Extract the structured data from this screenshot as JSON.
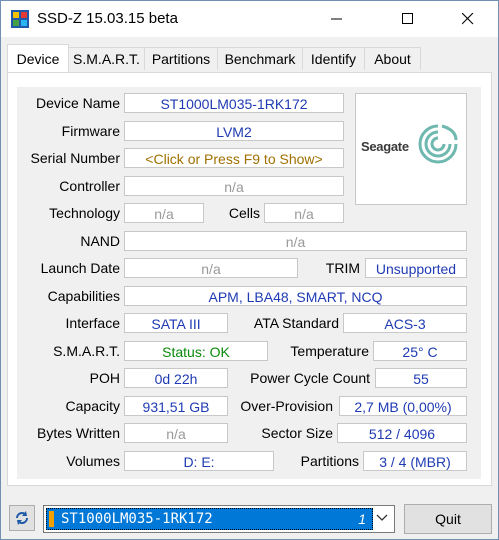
{
  "window": {
    "title": "SSD-Z 15.03.15 beta"
  },
  "tabs": [
    "Device",
    "S.M.A.R.T.",
    "Partitions",
    "Benchmark",
    "Identify",
    "About"
  ],
  "device": {
    "device_name_label": "Device Name",
    "device_name": "ST1000LM035-1RK172",
    "firmware_label": "Firmware",
    "firmware": "LVM2",
    "serial_label": "Serial Number",
    "serial": "<Click or Press F9 to Show>",
    "controller_label": "Controller",
    "controller": "n/a",
    "technology_label": "Technology",
    "technology": "n/a",
    "cells_label": "Cells",
    "cells": "n/a",
    "nand_label": "NAND",
    "nand": "n/a",
    "launch_label": "Launch Date",
    "launch": "n/a",
    "trim_label": "TRIM",
    "trim": "Unsupported",
    "capabilities_label": "Capabilities",
    "capabilities": "APM, LBA48, SMART, NCQ",
    "interface_label": "Interface",
    "interface": "SATA III",
    "ata_label": "ATA Standard",
    "ata": "ACS-3",
    "smart_label": "S.M.A.R.T.",
    "smart": "Status: OK",
    "temp_label": "Temperature",
    "temp": "25° C",
    "poh_label": "POH",
    "poh": "0d 22h",
    "pcc_label": "Power Cycle Count",
    "pcc": "55",
    "capacity_label": "Capacity",
    "capacity": "931,51 GB",
    "op_label": "Over-Provision",
    "op": "2,7 MB (0,00%)",
    "bw_label": "Bytes Written",
    "bw": "n/a",
    "sector_label": "Sector Size",
    "sector": "512 / 4096",
    "volumes_label": "Volumes",
    "volumes": "D:  E:",
    "partitions_label": "Partitions",
    "partitions": "3 / 4 (MBR)"
  },
  "logo": {
    "brand": "Seagate"
  },
  "bottom": {
    "drive": "ST1000LM035-1RK172",
    "drive_index": "1",
    "quit_label": "Quit"
  },
  "colors": {
    "value_blue": "#1f3bb3",
    "na_gray": "#9a9a9a",
    "ok_green": "#0a8a0a",
    "serial_gold": "#a07000",
    "select_blue": "#0078d7"
  }
}
